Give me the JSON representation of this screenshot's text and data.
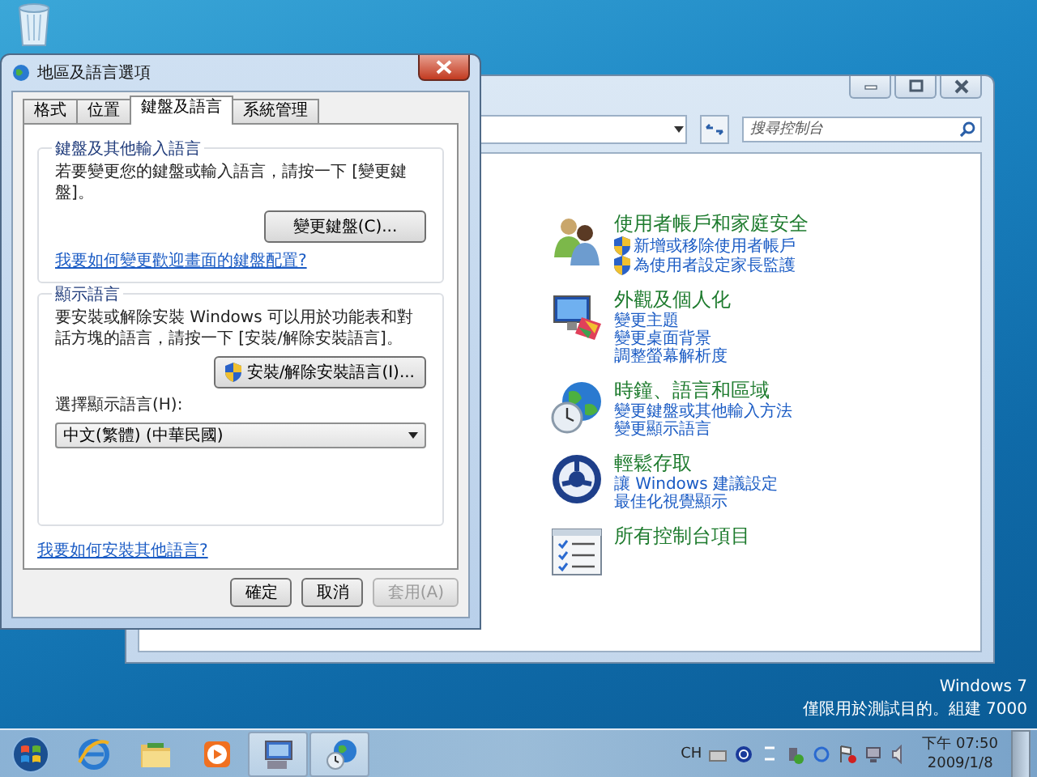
{
  "desktop": {
    "notice": [
      "Windows 7",
      "僅限用於測試目的。組建 7000"
    ]
  },
  "control_panel": {
    "search": {
      "placeholder": "搜尋控制台"
    },
    "categories": [
      {
        "kind": "users",
        "title": "使用者帳戶和家庭安全",
        "links": [
          {
            "label": "新增或移除使用者帳戶",
            "shield": true
          },
          {
            "label": "為使用者設定家長監護",
            "shield": true
          }
        ]
      },
      {
        "kind": "appearance",
        "title": "外觀及個人化",
        "links": [
          {
            "label": "變更主題",
            "shield": false
          },
          {
            "label": "變更桌面背景",
            "shield": false
          },
          {
            "label": "調整螢幕解析度",
            "shield": false
          }
        ]
      },
      {
        "kind": "clock",
        "title": "時鐘、語言和區域",
        "links": [
          {
            "label": "變更鍵盤或其他輸入方法",
            "shield": false
          },
          {
            "label": "變更顯示語言",
            "shield": false
          }
        ]
      },
      {
        "kind": "access",
        "title": "輕鬆存取",
        "links": [
          {
            "label": "讓 Windows 建議設定",
            "shield": false
          },
          {
            "label": "最佳化視覺顯示",
            "shield": false
          }
        ]
      },
      {
        "kind": "all",
        "title": "所有控制台項目"
      }
    ]
  },
  "dialog": {
    "title": "地區及語言選項",
    "tabs": [
      {
        "label": "格式",
        "selected": false
      },
      {
        "label": "位置",
        "selected": false
      },
      {
        "label": "鍵盤及語言",
        "selected": true
      },
      {
        "label": "系統管理",
        "selected": false
      }
    ],
    "keyboard_group": {
      "heading": "鍵盤及其他輸入語言",
      "text": "若要變更您的鍵盤或輸入語言，請按一下 [變更鍵盤]。",
      "button": "變更鍵盤(C)...",
      "link": "我要如何變更歡迎畫面的鍵盤配置?"
    },
    "display_group": {
      "heading": "顯示語言",
      "text": "要安裝或解除安裝 Windows 可以用於功能表和對話方塊的語言，請按一下 [安裝/解除安裝語言]。",
      "button": "安裝/解除安裝語言(I)...",
      "select_label": "選擇顯示語言(H):",
      "select_value": "中文(繁體) (中華民國)"
    },
    "link": "我要如何安裝其他語言?",
    "buttons": [
      {
        "label": "確定",
        "disabled": false
      },
      {
        "label": "取消",
        "disabled": false
      },
      {
        "label": "套用(A)",
        "disabled": true
      }
    ]
  },
  "taskbar": {
    "apps": [
      {
        "kind": "browser",
        "active": false
      },
      {
        "kind": "folder",
        "active": false
      },
      {
        "kind": "media",
        "active": false
      },
      {
        "kind": "control-panel",
        "active": true
      },
      {
        "kind": "region",
        "active": true
      }
    ],
    "tray": {
      "input_language": "CH",
      "time": "下午 07:50",
      "date": "2009/1/8"
    }
  }
}
